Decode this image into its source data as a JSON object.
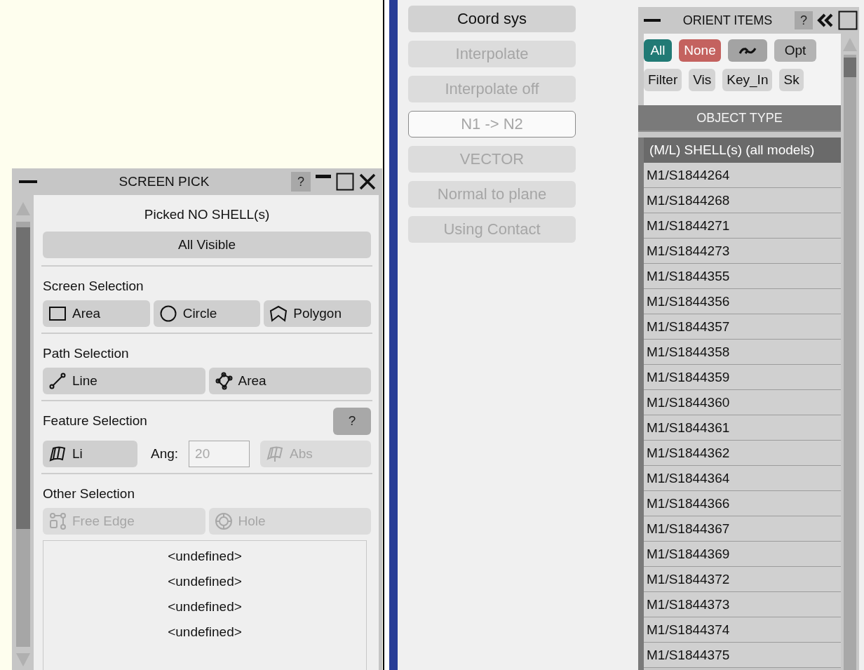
{
  "screen_pick": {
    "title": "SCREEN PICK",
    "help": "?",
    "status": "Picked NO SHELL(s)",
    "all_visible": {
      "label": "All Visible",
      "disabled": false
    },
    "sections": [
      {
        "title": "Screen Selection",
        "buttons": [
          {
            "label": "Area",
            "disabled": false
          },
          {
            "label": "Circle",
            "disabled": false
          },
          {
            "label": "Polygon",
            "disabled": false
          }
        ]
      },
      {
        "title": "Path Selection",
        "buttons": [
          {
            "label": "Line",
            "disabled": false
          },
          {
            "label": "Area",
            "disabled": false
          }
        ]
      },
      {
        "title": "Feature Selection",
        "help": "?",
        "buttons": [
          {
            "label": "Li",
            "disabled": false
          }
        ],
        "angle": {
          "label": "Ang:",
          "value": "20",
          "disabled": true
        },
        "after": [
          {
            "label": "Abs",
            "disabled": true
          }
        ]
      },
      {
        "title": "Other Selection",
        "buttons": [
          {
            "label": "Free Edge",
            "disabled": true
          },
          {
            "label": "Hole",
            "disabled": true
          }
        ]
      }
    ],
    "list": [
      "<undefined>",
      "<undefined>",
      "<undefined>",
      "<undefined>"
    ]
  },
  "actions": [
    {
      "label": "Coord sys",
      "disabled": false,
      "focused": false
    },
    {
      "label": "Interpolate",
      "disabled": true,
      "focused": false
    },
    {
      "label": "Interpolate off",
      "disabled": true,
      "focused": false
    },
    {
      "label": "N1 -> N2",
      "disabled": true,
      "focused": true
    },
    {
      "label": "VECTOR",
      "disabled": true,
      "focused": false
    },
    {
      "label": "Normal to plane",
      "disabled": true,
      "focused": false
    },
    {
      "label": "Using Contact",
      "disabled": true,
      "focused": false
    }
  ],
  "orient_items": {
    "title": "ORIENT ITEMS",
    "help": "?",
    "top_buttons": [
      {
        "kind": "text",
        "label": "All",
        "color": "#217a75"
      },
      {
        "kind": "text",
        "label": "None",
        "color": "#c4625f"
      },
      {
        "kind": "icon",
        "color": "#a3a3a3"
      },
      {
        "kind": "text",
        "label": "Opt",
        "color": "#b3b3b3"
      }
    ],
    "tool_buttons": [
      "Filter",
      "Vis",
      "Key_In",
      "Sk"
    ],
    "column": "OBJECT TYPE",
    "group": "(M/L) SHELL(s) (all models)",
    "rows": [
      "M1/S1844264",
      "M1/S1844268",
      "M1/S1844271",
      "M1/S1844273",
      "M1/S1844355",
      "M1/S1844356",
      "M1/S1844357",
      "M1/S1844358",
      "M1/S1844359",
      "M1/S1844360",
      "M1/S1844361",
      "M1/S1844362",
      "M1/S1844364",
      "M1/S1844366",
      "M1/S1844367",
      "M1/S1844369",
      "M1/S1844372",
      "M1/S1844373",
      "M1/S1844374",
      "M1/S1844375"
    ]
  }
}
